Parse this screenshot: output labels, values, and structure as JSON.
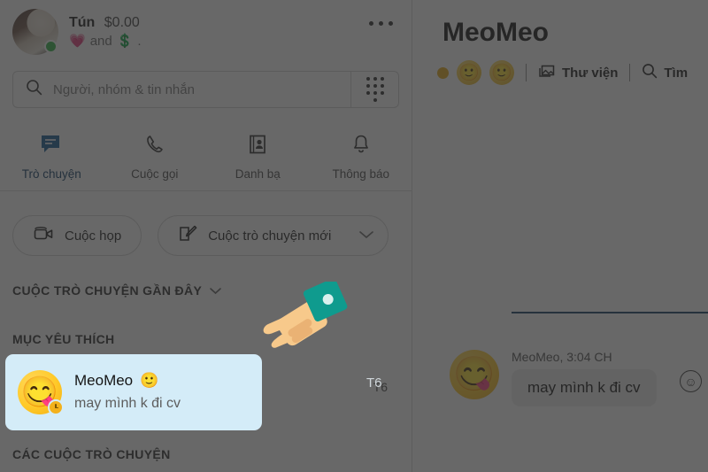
{
  "profile": {
    "name": "Tún",
    "amount": "$0.00",
    "mood_prefix": "",
    "heart_emoji": "💗",
    "mood_and": "and",
    "money_emoji": "💲",
    "mood_suffix": ".",
    "status": "online"
  },
  "header": {
    "more_menu_label": "..."
  },
  "search": {
    "placeholder": "Người, nhóm & tin nhắn",
    "value": ""
  },
  "tabs": [
    {
      "label": "Trò chuyện",
      "icon": "chat-icon",
      "active": true
    },
    {
      "label": "Cuộc gọi",
      "icon": "phone-icon",
      "active": false
    },
    {
      "label": "Danh bạ",
      "icon": "contacts-icon",
      "active": false
    },
    {
      "label": "Thông báo",
      "icon": "bell-icon",
      "active": false
    }
  ],
  "actions": {
    "meeting_label": "Cuộc họp",
    "new_chat_label": "Cuộc trò chuyện mới"
  },
  "sections": {
    "recent": "CUỘC TRÒ CHUYỆN GẦN ĐÂY",
    "favorites": "MỤC YÊU THÍCH",
    "all_chats": "CÁC CUỘC TRÒ CHUYỆN"
  },
  "chat_item": {
    "name": "MeoMeo",
    "name_emoji": "🙂",
    "avatar_emoji": "😋",
    "preview": "may mình k đi cv",
    "time": "T6"
  },
  "conversation": {
    "title": "MeoMeo",
    "library_label": "Thư viện",
    "search_label": "Tìm",
    "face_emoji_1": "🙂",
    "face_emoji_2": "🙂",
    "message": {
      "sender_time": "MeoMeo, 3:04 CH",
      "text": "may mình k đi cv",
      "avatar_emoji": "😋",
      "react_icon": "☺"
    }
  },
  "colors": {
    "accent_blue": "#0f3c64",
    "highlight_bg": "#d4ecf8",
    "online_green": "#2fb344",
    "cursor_sleeve": "#0f9b8e",
    "divider_blue": "#123f63"
  }
}
